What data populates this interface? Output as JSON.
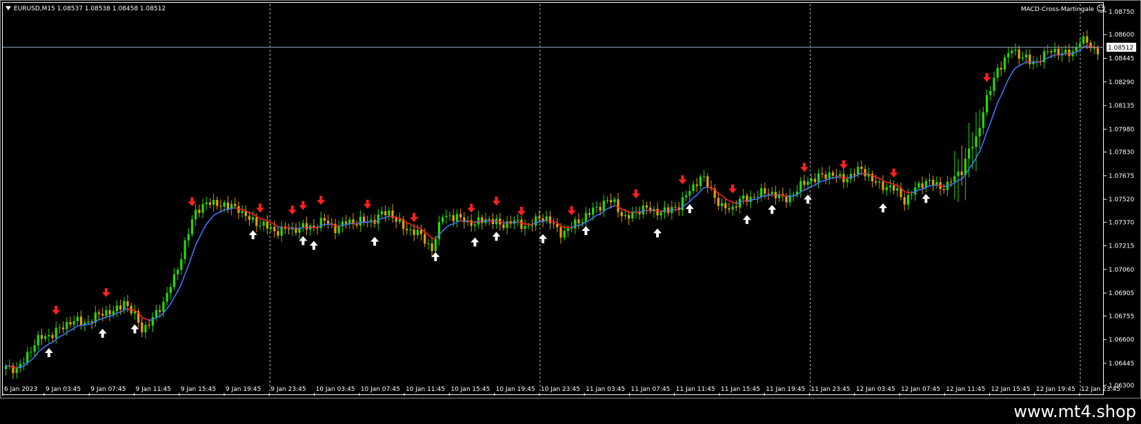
{
  "header": {
    "symbol_line": "EURUSD,M15  1.08537 1.08538 1.08458 1.08512",
    "indicator_name": "MACD-Cross-Martingale",
    "smiley": "☺"
  },
  "price_label": "1.08512",
  "watermark": "www.mt4.shop",
  "colors": {
    "background": "#000000",
    "bull": "#22dd00",
    "bear": "#e8a000",
    "ma_up": "#3a78ff",
    "ma_down": "#ff1e1e",
    "arrow_up": "#ffffff",
    "arrow_down": "#ff2020",
    "grid": "#bbbbbb",
    "frame": "#ffffff",
    "price_line": "#8aa0b8"
  },
  "chart_data": {
    "type": "candlestick",
    "symbol": "EURUSD",
    "timeframe": "M15",
    "ylim": [
      1.0625,
      1.088
    ],
    "y_ticks": [
      "1.08750",
      "1.08600",
      "1.08445",
      "1.08290",
      "1.08135",
      "1.07980",
      "1.07830",
      "1.07675",
      "1.07520",
      "1.07370",
      "1.07215",
      "1.07060",
      "1.06905",
      "1.06755",
      "1.06600",
      "1.06445",
      "1.06300"
    ],
    "x_labels": [
      "6 Jan 2023",
      "9 Jan 03:45",
      "9 Jan 07:45",
      "9 Jan 11:45",
      "9 Jan 15:45",
      "9 Jan 19:45",
      "9 Jan 23:45",
      "10 Jan 03:45",
      "10 Jan 07:45",
      "10 Jan 11:45",
      "10 Jan 15:45",
      "10 Jan 19:45",
      "10 Jan 23:45",
      "11 Jan 03:45",
      "11 Jan 07:45",
      "11 Jan 11:45",
      "11 Jan 15:45",
      "11 Jan 19:45",
      "11 Jan 23:45",
      "12 Jan 03:45",
      "12 Jan 07:45",
      "12 Jan 11:45",
      "12 Jan 15:45",
      "12 Jan 19:45",
      "12 Jan 23:45"
    ],
    "day_separators": [
      "9 Jan 23:45",
      "10 Jan 23:45",
      "11 Jan 23:45",
      "12 Jan 23:45"
    ],
    "close_trajectory": [
      [
        0,
        1.0641
      ],
      [
        3,
        1.064
      ],
      [
        6,
        1.0652
      ],
      [
        10,
        1.066
      ],
      [
        14,
        1.0667
      ],
      [
        18,
        1.067
      ],
      [
        22,
        1.0673
      ],
      [
        26,
        1.0675
      ],
      [
        30,
        1.0679
      ],
      [
        33,
        1.0686
      ],
      [
        35,
        1.0677
      ],
      [
        38,
        1.0667
      ],
      [
        41,
        1.0675
      ],
      [
        44,
        1.0683
      ],
      [
        47,
        1.07
      ],
      [
        50,
        1.0725
      ],
      [
        53,
        1.0742
      ],
      [
        56,
        1.075
      ],
      [
        59,
        1.0751
      ],
      [
        62,
        1.0745
      ],
      [
        65,
        1.0747
      ],
      [
        68,
        1.074
      ],
      [
        71,
        1.0734
      ],
      [
        74,
        1.0733
      ],
      [
        77,
        1.0733
      ],
      [
        80,
        1.073
      ],
      [
        83,
        1.0735
      ],
      [
        86,
        1.0735
      ],
      [
        89,
        1.0736
      ],
      [
        92,
        1.0734
      ],
      [
        95,
        1.0738
      ],
      [
        98,
        1.0735
      ],
      [
        101,
        1.0739
      ],
      [
        104,
        1.0741
      ],
      [
        107,
        1.0742
      ],
      [
        110,
        1.0737
      ],
      [
        113,
        1.0732
      ],
      [
        116,
        1.0726
      ],
      [
        119,
        1.0721
      ],
      [
        122,
        1.0742
      ],
      [
        125,
        1.0738
      ],
      [
        128,
        1.0741
      ],
      [
        131,
        1.0735
      ],
      [
        134,
        1.0738
      ],
      [
        137,
        1.0738
      ],
      [
        140,
        1.0736
      ],
      [
        143,
        1.0735
      ],
      [
        146,
        1.0736
      ],
      [
        149,
        1.074
      ],
      [
        152,
        1.0736
      ],
      [
        155,
        1.0732
      ],
      [
        158,
        1.0733
      ],
      [
        161,
        1.0738
      ],
      [
        164,
        1.0747
      ],
      [
        167,
        1.0749
      ],
      [
        170,
        1.0749
      ],
      [
        173,
        1.0741
      ],
      [
        176,
        1.0743
      ],
      [
        179,
        1.0745
      ],
      [
        182,
        1.0746
      ],
      [
        185,
        1.0743
      ],
      [
        188,
        1.0747
      ],
      [
        191,
        1.076
      ],
      [
        194,
        1.0765
      ],
      [
        197,
        1.0758
      ],
      [
        200,
        1.0748
      ],
      [
        203,
        1.0745
      ],
      [
        206,
        1.0752
      ],
      [
        209,
        1.0756
      ],
      [
        212,
        1.0755
      ],
      [
        215,
        1.0755
      ],
      [
        218,
        1.0754
      ],
      [
        221,
        1.0756
      ],
      [
        224,
        1.0765
      ],
      [
        227,
        1.0768
      ],
      [
        230,
        1.0767
      ],
      [
        233,
        1.0766
      ],
      [
        236,
        1.0769
      ],
      [
        239,
        1.077
      ],
      [
        242,
        1.0765
      ],
      [
        245,
        1.0762
      ],
      [
        248,
        1.0757
      ],
      [
        251,
        1.0752
      ],
      [
        254,
        1.076
      ],
      [
        257,
        1.0762
      ],
      [
        260,
        1.0762
      ],
      [
        263,
        1.0762
      ],
      [
        265,
        1.0765
      ],
      [
        267,
        1.077
      ],
      [
        269,
        1.0785
      ],
      [
        271,
        1.0793
      ],
      [
        273,
        1.081
      ],
      [
        275,
        1.0822
      ],
      [
        277,
        1.0838
      ],
      [
        279,
        1.0845
      ],
      [
        281,
        1.0851
      ],
      [
        283,
        1.0845
      ],
      [
        286,
        1.0842
      ],
      [
        289,
        1.0846
      ],
      [
        292,
        1.0848
      ],
      [
        295,
        1.0848
      ],
      [
        298,
        1.085
      ],
      [
        300,
        1.0855
      ],
      [
        302,
        1.0853
      ],
      [
        304,
        1.0851
      ]
    ],
    "signals_buy": [
      12,
      27,
      36,
      69,
      83,
      86,
      103,
      120,
      131,
      137,
      150,
      162,
      182,
      191,
      207,
      214,
      224,
      245,
      257
    ],
    "signals_sell": [
      14,
      28,
      52,
      71,
      80,
      83,
      88,
      101,
      114,
      130,
      137,
      144,
      158,
      176,
      189,
      203,
      223,
      234,
      248,
      274
    ]
  }
}
